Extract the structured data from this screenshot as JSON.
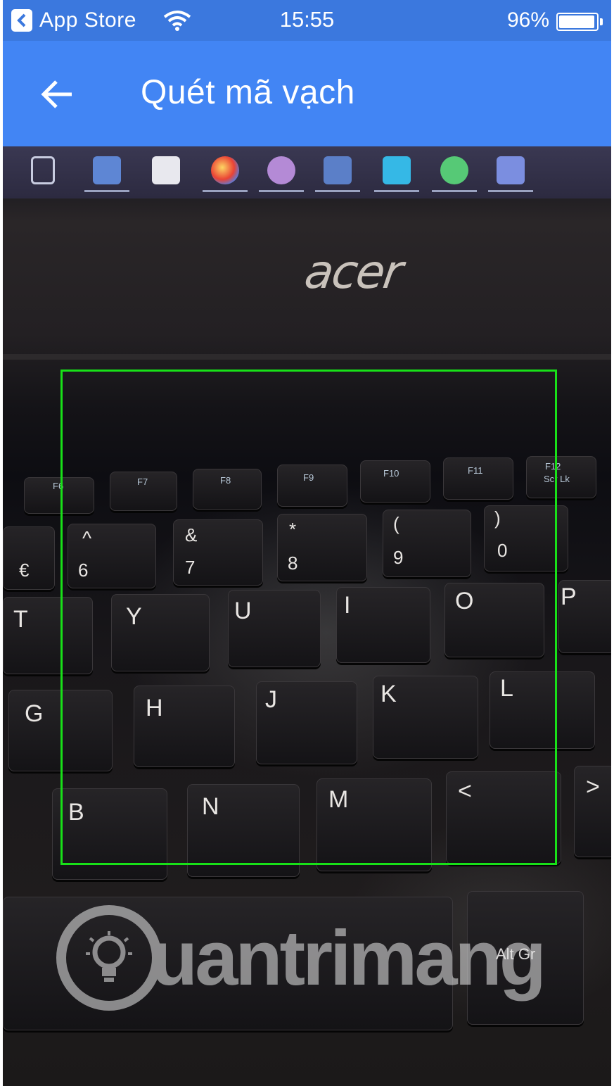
{
  "status_bar": {
    "back_app_label": "App Store",
    "time": "15:55",
    "battery_percent": "96%",
    "battery_level": 0.96
  },
  "app_bar": {
    "title": "Quét mã vạch"
  },
  "camera": {
    "laptop_brand": "acer",
    "keys": {
      "f6": "F6",
      "f7": "F7",
      "f8": "F8",
      "f9": "F9",
      "f10": "F10",
      "f11": "F11",
      "f12": "F12",
      "scrlk": "Scr Lk",
      "caret": "^",
      "six": "6",
      "amp": "&",
      "seven": "7",
      "star": "*",
      "eight": "8",
      "lparen": "(",
      "nine": "9",
      "rparen": ")",
      "zero": "0",
      "euro": "€",
      "t": "T",
      "y": "Y",
      "u": "U",
      "i": "I",
      "o": "O",
      "p": "P",
      "g": "G",
      "h": "H",
      "j": "J",
      "k": "K",
      "l": "L",
      "b": "B",
      "n": "N",
      "m": "M",
      "lt": "<",
      "gt": ">",
      "altgr": "Alt Gr"
    },
    "watermark": "uantrimang"
  },
  "colors": {
    "status_bar_bg": "#3b78de",
    "app_bar_bg": "#4285f4",
    "scan_frame": "#18e018"
  }
}
